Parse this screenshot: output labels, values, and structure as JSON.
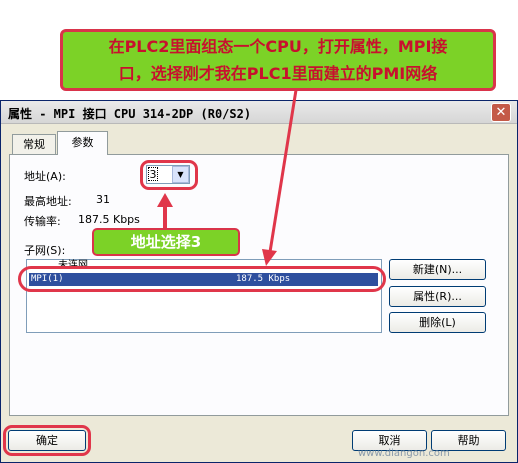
{
  "annotations": {
    "top_note_line1": "在PLC2里面组态一个CPU，打开属性，MPI接",
    "top_note_line2": "口，选择刚才我在PLC1里面建立的PMI网络",
    "address_note": "地址选择3",
    "watermark": "www.diangon.com",
    "highlight_color": "#E0364A",
    "note_bg_color": "#7CD227"
  },
  "dialog": {
    "title": "属性 - MPI 接口  CPU 314-2DP (R0/S2)",
    "close_label": "✕",
    "tabs": [
      {
        "label": "常规"
      },
      {
        "label": "参数"
      }
    ],
    "active_tab": "参数",
    "address_label": "地址(A):",
    "address_value": "3",
    "highest_address_label": "最高地址:",
    "highest_address_value": "31",
    "baud_label": "传输率:",
    "baud_value": "187.5 Kbps",
    "subnet_label": "子网(S):",
    "subnet_rows": [
      {
        "name": "未连网",
        "rate": ""
      },
      {
        "name": "MPI(1)",
        "rate": "187.5 Kbps"
      }
    ],
    "buttons": {
      "new": "新建(N)...",
      "properties": "属性(R)...",
      "delete": "删除(L)",
      "ok": "确定",
      "cancel": "取消",
      "help": "帮助"
    }
  }
}
